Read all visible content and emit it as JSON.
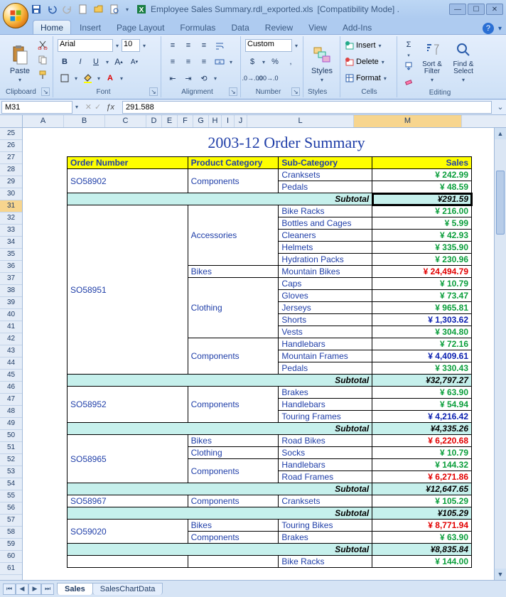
{
  "title": {
    "filename": "Employee Sales Summary.rdl_exported.xls",
    "mode": "[Compatibility Mode] ."
  },
  "tabs": [
    "Home",
    "Insert",
    "Page Layout",
    "Formulas",
    "Data",
    "Review",
    "View",
    "Add-Ins"
  ],
  "active_tab": "Home",
  "ribbon": {
    "clipboard": {
      "label": "Clipboard",
      "paste": "Paste"
    },
    "font": {
      "label": "Font",
      "name": "Arial",
      "size": "10"
    },
    "alignment": {
      "label": "Alignment"
    },
    "number": {
      "label": "Number",
      "format": "Custom"
    },
    "styles": {
      "label": "Styles",
      "button": "Styles"
    },
    "cells": {
      "label": "Cells",
      "insert": "Insert",
      "delete": "Delete",
      "format": "Format"
    },
    "editing": {
      "label": "Editing",
      "sort": "Sort & Filter",
      "find": "Find & Select"
    }
  },
  "namebox": "M31",
  "formula": "291.588",
  "columns": [
    "A",
    "B",
    "C",
    "D",
    "E",
    "F",
    "G",
    "H",
    "I",
    "J",
    "L",
    "M"
  ],
  "selected_col": "M",
  "row_start": 25,
  "row_end": 61,
  "selected_row": 31,
  "sheet": {
    "title": "2003-12 Order Summary",
    "headers": [
      "Order Number",
      "Product Category",
      "Sub-Category",
      "Sales"
    ],
    "orders": [
      {
        "order": "SO58902",
        "groups": [
          {
            "cat": "Components",
            "rows": [
              {
                "sub": "Cranksets",
                "val": "¥ 242.99",
                "c": "green"
              },
              {
                "sub": "Pedals",
                "val": "¥ 48.59",
                "c": "green"
              }
            ]
          }
        ],
        "subtotal": "¥291.59",
        "selected": true
      },
      {
        "order": "SO58951",
        "groups": [
          {
            "cat": "Accessories",
            "rows": [
              {
                "sub": "Bike Racks",
                "val": "¥ 216.00",
                "c": "green"
              },
              {
                "sub": "Bottles and Cages",
                "val": "¥ 5.99",
                "c": "green"
              },
              {
                "sub": "Cleaners",
                "val": "¥ 42.93",
                "c": "green"
              },
              {
                "sub": "Helmets",
                "val": "¥ 335.90",
                "c": "green"
              },
              {
                "sub": "Hydration Packs",
                "val": "¥ 230.96",
                "c": "green"
              }
            ]
          },
          {
            "cat": "Bikes",
            "rows": [
              {
                "sub": "Mountain Bikes",
                "val": "¥ 24,494.79",
                "c": "red"
              }
            ]
          },
          {
            "cat": "Clothing",
            "rows": [
              {
                "sub": "Caps",
                "val": "¥ 10.79",
                "c": "green"
              },
              {
                "sub": "Gloves",
                "val": "¥ 73.47",
                "c": "green"
              },
              {
                "sub": "Jerseys",
                "val": "¥ 965.81",
                "c": "green"
              },
              {
                "sub": "Shorts",
                "val": "¥ 1,303.62",
                "c": "blue"
              },
              {
                "sub": "Vests",
                "val": "¥ 304.80",
                "c": "green"
              }
            ]
          },
          {
            "cat": "Components",
            "rows": [
              {
                "sub": "Handlebars",
                "val": "¥ 72.16",
                "c": "green"
              },
              {
                "sub": "Mountain Frames",
                "val": "¥ 4,409.61",
                "c": "blue"
              },
              {
                "sub": "Pedals",
                "val": "¥ 330.43",
                "c": "green"
              }
            ]
          }
        ],
        "subtotal": "¥32,797.27"
      },
      {
        "order": "SO58952",
        "groups": [
          {
            "cat": "Components",
            "rows": [
              {
                "sub": "Brakes",
                "val": "¥ 63.90",
                "c": "green"
              },
              {
                "sub": "Handlebars",
                "val": "¥ 54.94",
                "c": "green"
              },
              {
                "sub": "Touring Frames",
                "val": "¥ 4,216.42",
                "c": "blue"
              }
            ]
          }
        ],
        "subtotal": "¥4,335.26"
      },
      {
        "order": "SO58965",
        "groups": [
          {
            "cat": "Bikes",
            "rows": [
              {
                "sub": "Road Bikes",
                "val": "¥ 6,220.68",
                "c": "red"
              }
            ]
          },
          {
            "cat": "Clothing",
            "rows": [
              {
                "sub": "Socks",
                "val": "¥ 10.79",
                "c": "green"
              }
            ]
          },
          {
            "cat": "Components",
            "rows": [
              {
                "sub": "Handlebars",
                "val": "¥ 144.32",
                "c": "green"
              },
              {
                "sub": "Road Frames",
                "val": "¥ 6,271.86",
                "c": "red"
              }
            ]
          }
        ],
        "subtotal": "¥12,647.65"
      },
      {
        "order": "SO58967",
        "groups": [
          {
            "cat": "Components",
            "rows": [
              {
                "sub": "Cranksets",
                "val": "¥ 105.29",
                "c": "green"
              }
            ]
          }
        ],
        "subtotal": "¥105.29"
      },
      {
        "order": "SO59020",
        "groups": [
          {
            "cat": "Bikes",
            "rows": [
              {
                "sub": "Touring Bikes",
                "val": "¥ 8,771.94",
                "c": "red"
              }
            ]
          },
          {
            "cat": "Components",
            "rows": [
              {
                "sub": "Brakes",
                "val": "¥ 63.90",
                "c": "green"
              }
            ]
          }
        ],
        "subtotal": "¥8,835.84"
      }
    ],
    "trailing": [
      {
        "sub": "Bike Racks",
        "val": "¥ 144.00",
        "c": "green"
      }
    ]
  },
  "sheets": [
    "Sales",
    "SalesChartData"
  ]
}
